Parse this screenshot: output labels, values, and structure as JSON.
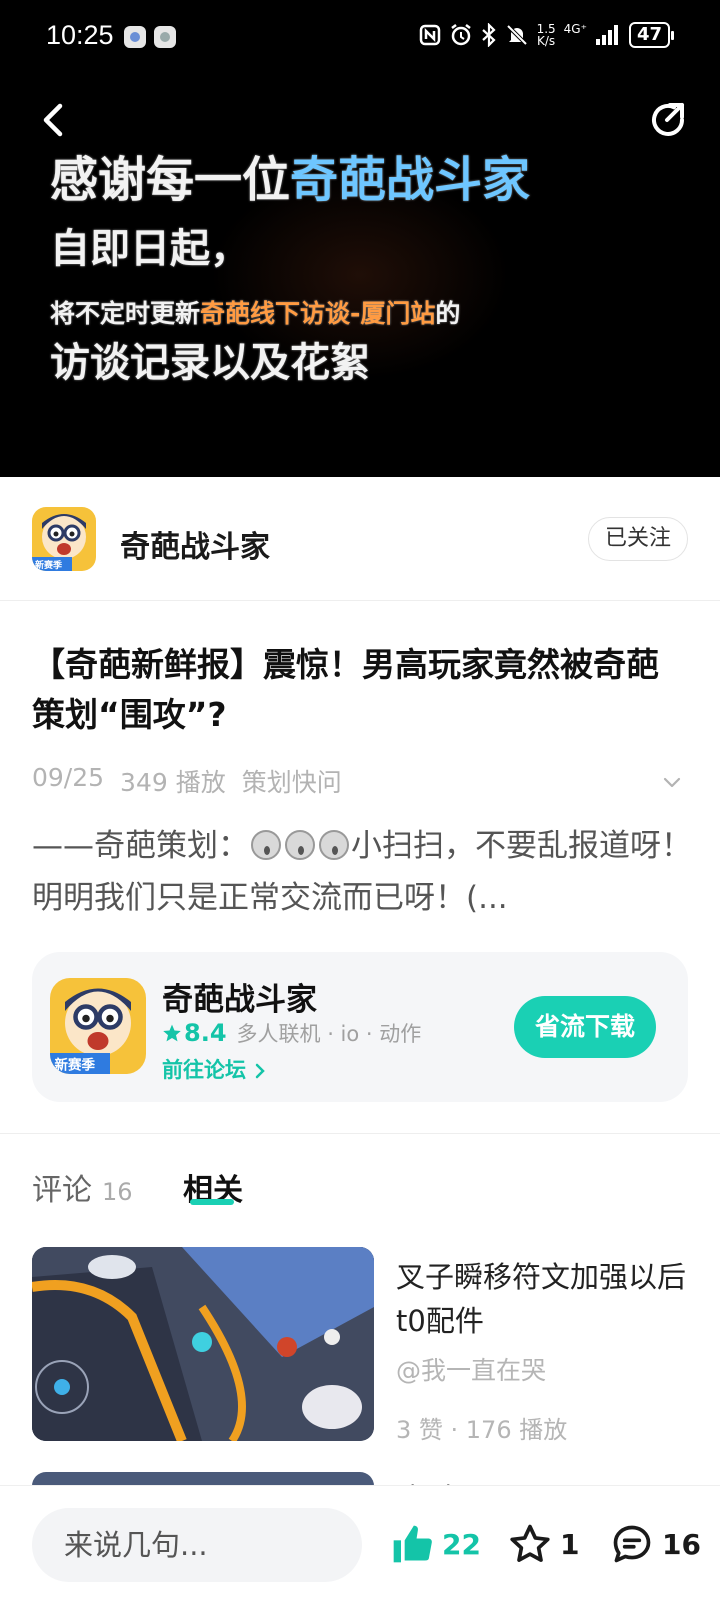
{
  "status_bar": {
    "time": "10:25",
    "network_speed_value": "1.5",
    "network_speed_unit": "K/s",
    "network_type": "4G⁺",
    "battery": "47"
  },
  "video": {
    "line1_prefix": "感谢每一位",
    "line1_highlight": "奇葩战斗家",
    "line2": "自即日起，",
    "line3_prefix": "将不定时更新",
    "line3_highlight": "奇葩线下访谈-厦门站",
    "line3_suffix": "的",
    "line4": "访谈记录以及花絮"
  },
  "author": {
    "name": "奇葩战斗家",
    "avatar_badge": "新赛季",
    "follow_label": "已关注"
  },
  "post": {
    "title": "【奇葩新鲜报】震惊！男高玩家竟然被奇葩策划“围攻”?",
    "date": "09/25",
    "plays": "349 播放",
    "category": "策划快问",
    "desc_prefix": "——奇葩策划：",
    "desc_suffix": "小扫扫，不要乱报道呀！明明我们只是正常交流而已呀！(..."
  },
  "game_card": {
    "name": "奇葩战斗家",
    "rating": "8.4",
    "tags": "多人联机 · io · 动作",
    "forum_link": "前往论坛",
    "download_label": "省流下载",
    "icon_badge": "新赛季"
  },
  "tabs": {
    "comments_label": "评论",
    "comments_count": "16",
    "related_label": "相关"
  },
  "related": [
    {
      "title": "叉子瞬移符文加强以后t0配件",
      "author": "@我一直在哭",
      "stats": "3 赞 · 176 播放"
    },
    {
      "title": "这对吗"
    }
  ],
  "bottom_bar": {
    "comment_placeholder": "来说几句...",
    "likes": "22",
    "favorites": "1",
    "comments": "16"
  },
  "colors": {
    "accent": "#1ad0b4",
    "video_highlight_blue": "#6ec6ff",
    "video_highlight_orange": "#ff9b42"
  }
}
